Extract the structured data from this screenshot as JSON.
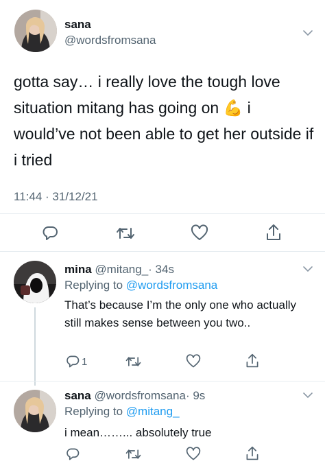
{
  "main_tweet": {
    "display_name": "sana",
    "handle": "@wordsfromsana",
    "text_before_emoji": "gotta say… i really love the tough love situation mitang has going on",
    "emoji": "💪",
    "text_after_emoji": "i would’ve not been able to get her outside if i tried",
    "timestamp": "11:44 · 31/12/21"
  },
  "replies": [
    {
      "display_name": "mina",
      "handle": "@mitang_",
      "time": "· 34s",
      "replying_prefix": "Replying to",
      "replying_to": "@wordsfromsana",
      "text": "That’s because I’m the only one who actually still makes sense between you two..",
      "reply_count": "1"
    },
    {
      "display_name": "sana",
      "handle": "@wordsfromsana",
      "time": "· 9s",
      "replying_prefix": "Replying to",
      "replying_to": "@mitang_",
      "text": "i mean……... absolutely true",
      "reply_count": ""
    }
  ],
  "colors": {
    "accent": "#1d9bf0",
    "muted": "#536471",
    "text": "#0f1419",
    "divider": "#e6ecf0"
  },
  "icons": [
    "chevron-down-icon",
    "reply-icon",
    "retweet-icon",
    "like-icon",
    "share-icon"
  ]
}
